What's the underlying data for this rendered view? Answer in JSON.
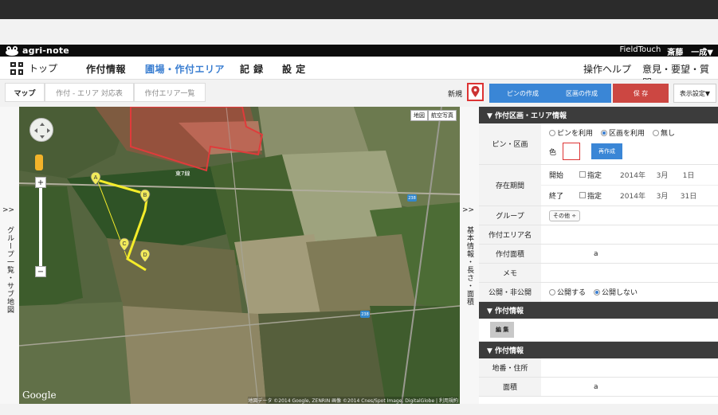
{
  "header": {
    "brand": "agri-note",
    "right_app": "FieldTouch",
    "user": "斎藤　一成▼"
  },
  "nav": {
    "top": "トップ",
    "items": [
      "作付情報",
      "圃場・作付エリア",
      "記 録",
      "設 定"
    ],
    "active_index": 1,
    "right": [
      "操作ヘルプ",
      "意見・要望・質問"
    ]
  },
  "subbar": {
    "tabs": [
      "マップ",
      "作付 - エリア 対応表",
      "作付エリア一覧"
    ],
    "new_label": "新規",
    "pin_button": "ピンの作成",
    "area_button": "区画の作成",
    "save_button": "保 存",
    "display_button": "表示設定▼"
  },
  "side": {
    "left_arrows": ">>",
    "left_label": "グループ一覧・サブ地図",
    "mid_arrows": ">>",
    "mid_label": "基本情報・長さ・面積"
  },
  "map": {
    "type_buttons": [
      "地図",
      "航空写真"
    ],
    "village_label": "東7線",
    "routes": [
      "238",
      "238"
    ],
    "markers": [
      "A",
      "B",
      "C",
      "D"
    ],
    "google": "Google",
    "copyright": "地図データ ©2014 Google, ZENRIN 画像 ©2014 Cnes/Spot Image, DigitalGlobe | 利用規約"
  },
  "panel": {
    "section1": "▼ 作付区画・エリア情報",
    "pin_area_label": "ピン・区画",
    "pin_options": [
      "ピンを利用",
      "区画を利用",
      "無し"
    ],
    "pin_selected": 1,
    "color_label": "色",
    "recreate_button": "再作成",
    "period_label": "存在期間",
    "start_label": "開始",
    "end_label": "終了",
    "specify_label": "指定",
    "start": {
      "year": "2014年",
      "month": "3月",
      "day": "1日"
    },
    "end": {
      "year": "2014年",
      "month": "3月",
      "day": "31日"
    },
    "group_label": "グループ",
    "group_value": "その他 ÷",
    "area_name_label": "作付エリア名",
    "area_name_value": "",
    "area_size_label": "作付面積",
    "area_size_value": "a",
    "memo_label": "メモ",
    "memo_value": "",
    "public_label": "公開・非公開",
    "public_options": [
      "公開する",
      "公開しない"
    ],
    "public_selected": 1,
    "section2": "▼ 作付情報",
    "edit_button": "編 集",
    "section3": "▼ 作付情報",
    "address_label": "地番・住所",
    "address_value": "",
    "area2_label": "面積",
    "area2_value": "a"
  },
  "colors": {
    "accent_blue": "#3a86d6",
    "save_red": "#cc4742",
    "active_nav": "#3a7ed1",
    "polyline_yellow": "#f4ec2a",
    "polygon_red": "#e03b3b"
  }
}
